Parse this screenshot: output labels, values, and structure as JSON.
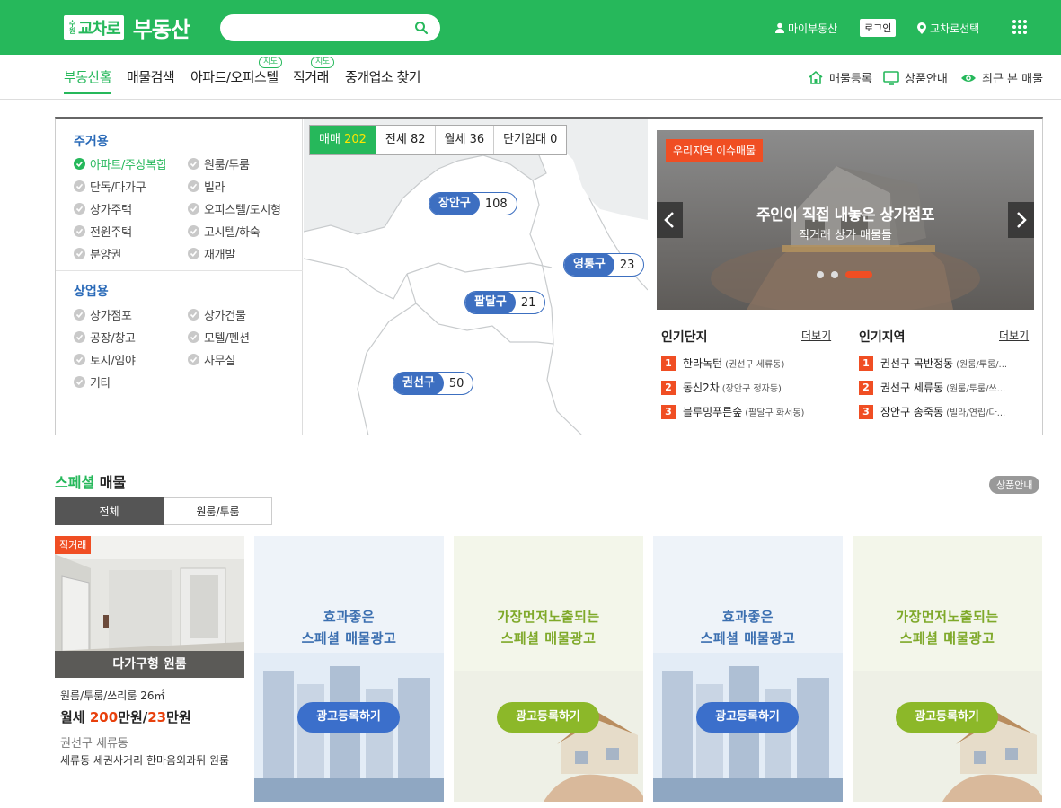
{
  "header": {
    "logo_small": "수원",
    "logo_box": "교차로",
    "logo_text": "부동산",
    "search_placeholder": "",
    "my_realty": "마이부동산",
    "login": "로그인",
    "region_select": "교차로선택",
    "brand_color": "#26b85b"
  },
  "subnav": {
    "tabs": [
      {
        "label": "부동산홈",
        "active": true
      },
      {
        "label": "매물검색"
      },
      {
        "label": "아파트/오피스텔",
        "badge": "지도"
      },
      {
        "label": "직거래",
        "badge": "지도"
      },
      {
        "label": "중개업소 찾기"
      }
    ],
    "utils": [
      "매물등록",
      "상품안내",
      "최근 본 매물"
    ]
  },
  "categories": {
    "residential_title": "주거용",
    "residential": [
      "아파트/주상복합",
      "원룸/투룸",
      "단독/다가구",
      "빌라",
      "상가주택",
      "오피스텔/도시형",
      "전원주택",
      "고시텔/하숙",
      "분양권",
      "재개발"
    ],
    "commercial_title": "상업용",
    "commercial": [
      "상가점포",
      "상가건물",
      "공장/창고",
      "모텔/펜션",
      "토지/임야",
      "사무실",
      "기타"
    ]
  },
  "map": {
    "deal_tabs": [
      {
        "label": "매매",
        "count": "202"
      },
      {
        "label": "전세",
        "count": "82"
      },
      {
        "label": "월세",
        "count": "36"
      },
      {
        "label": "단기임대",
        "count": "0"
      }
    ],
    "districts": [
      {
        "name": "장안구",
        "count": "108"
      },
      {
        "name": "영통구",
        "count": "23"
      },
      {
        "name": "팔달구",
        "count": "21"
      },
      {
        "name": "권선구",
        "count": "50"
      }
    ]
  },
  "banner": {
    "tag": "우리지역 이슈매물",
    "title": "주인이 직접 내놓은 상가점포",
    "subtitle": "직거래 상가 매물들"
  },
  "popular_complex": {
    "title": "인기단지",
    "more": "더보기",
    "items": [
      {
        "rank": "1",
        "name": "한라녹턴",
        "sub": "(권선구 세류동)"
      },
      {
        "rank": "2",
        "name": "동신2차",
        "sub": "(장안구 정자동)"
      },
      {
        "rank": "3",
        "name": "블루밍푸른숲",
        "sub": "(팔달구 화서동)"
      }
    ]
  },
  "popular_region": {
    "title": "인기지역",
    "more": "더보기",
    "items": [
      {
        "rank": "1",
        "name": "권선구 곡반정동",
        "sub": "(원룸/투룸/..."
      },
      {
        "rank": "2",
        "name": "권선구 세류동",
        "sub": "(원룸/투룸/쓰..."
      },
      {
        "rank": "3",
        "name": "장안구 송죽동",
        "sub": "(빌라/연립/다..."
      }
    ]
  },
  "special": {
    "title_green": "스페셜",
    "title_black": "매물",
    "guide": "상품안내",
    "tabs": [
      "전체",
      "원룸/투룸"
    ],
    "listing": {
      "tag": "직거래",
      "caption": "다가구형 원룸",
      "type_size": "원룸/투룸/쓰리룸 26㎡",
      "price_prefix": "월세 ",
      "deposit": "200",
      "unit1": "만원/",
      "rent": "23",
      "unit2": "만원",
      "location": "권선구 세류동",
      "desc": "세류동 세권사거리 한마음외과뒤 원룸"
    },
    "ads": [
      {
        "line1": "효과좋은",
        "line2": "스페셜 매물광고",
        "button": "광고등록하기",
        "color": "#3b6fcb"
      },
      {
        "line1": "가장먼저노출되는",
        "line2": "스페셜 매물광고",
        "button": "광고등록하기",
        "color": "#8cb829"
      },
      {
        "line1": "효과좋은",
        "line2": "스페셜 매물광고",
        "button": "광고등록하기",
        "color": "#3b6fcb"
      },
      {
        "line1": "가장먼저노출되는",
        "line2": "스페셜 매물광고",
        "button": "광고등록하기",
        "color": "#8cb829"
      }
    ]
  }
}
